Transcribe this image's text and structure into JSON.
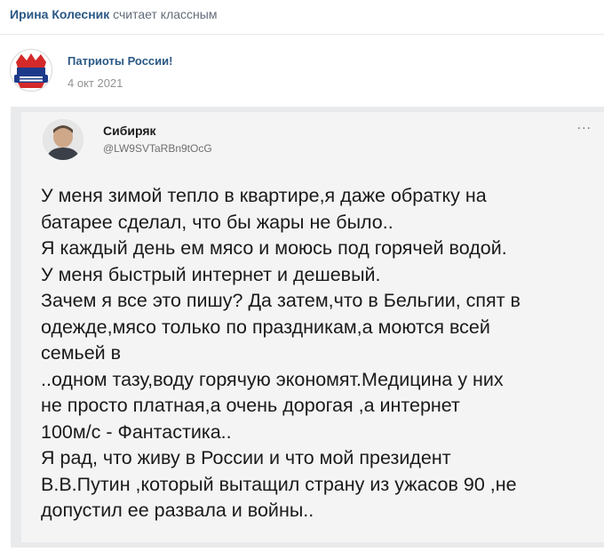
{
  "activity": {
    "actor": "Ирина Колесник",
    "action": "считает классным"
  },
  "post": {
    "author": "Патриоты России!",
    "date": "4 окт 2021",
    "avatar_icon": "patriots-logo-icon"
  },
  "tweet": {
    "name": "Сибиряк",
    "handle": "@LW9SVTaRBn9tOcG",
    "more": "...",
    "lines": [
      "У меня зимой тепло в квартире,я даже обратку на",
      "батарее сделал, что бы жары не было..",
      "Я каждый день ем мясо и моюсь под горячей водой.",
      "У меня быстрый интернет и дешевый.",
      "Зачем я все это пишу? Да затем,что в Бельгии, спят в",
      "одежде,мясо только по праздникам,а моются всей",
      "семьей в",
      "..одном тазу,воду горячую экономят.Медицина у них",
      "не просто платная,а очень дорогая ,а интернет",
      "100м/с - Фантастика..",
      "Я рад, что живу в России и что мой президент",
      "В.В.Путин ,который вытащил страну из ужасов 90 ,не",
      "допустил ее развала и войны.."
    ]
  },
  "colors": {
    "link": "#2a5885",
    "muted": "#939393",
    "logo_red": "#d42a2a",
    "logo_blue": "#1d3a8a"
  }
}
